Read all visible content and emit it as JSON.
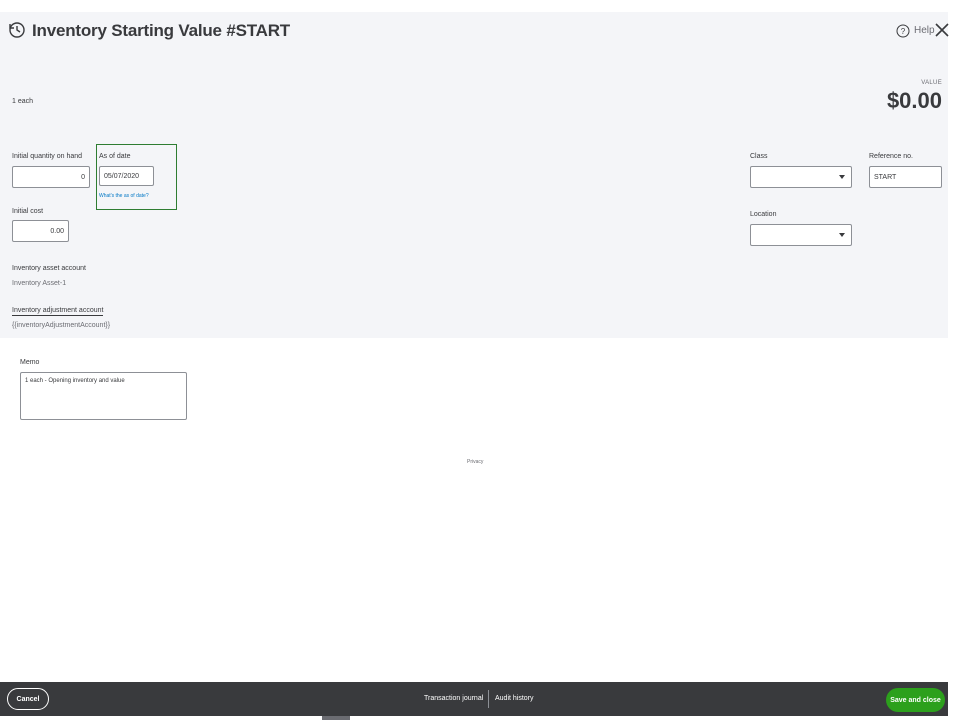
{
  "header": {
    "title": "Inventory Starting Value #START",
    "help_label": "Help"
  },
  "summary": {
    "unit": "1 each",
    "value_label": "VALUE",
    "value_amount": "$0.00"
  },
  "fields": {
    "initial_qty_label": "Initial quantity on hand",
    "initial_qty_value": "0",
    "as_of_label": "As of date",
    "as_of_value": "05/07/2020",
    "as_of_link": "What's the as of date?",
    "initial_cost_label": "Initial cost",
    "initial_cost_value": "0.00",
    "asset_account_label": "Inventory asset account",
    "asset_account_value": "Inventory Asset-1",
    "adjustment_account_label": "Inventory adjustment account",
    "adjustment_account_value": "{{inventoryAdjustmentAccount}}",
    "class_label": "Class",
    "class_value": "",
    "location_label": "Location",
    "location_value": "",
    "reference_label": "Reference no.",
    "reference_value": "START"
  },
  "memo": {
    "label": "Memo",
    "value": "1 each - Opening inventory and value"
  },
  "privacy_label": "Privacy",
  "footer": {
    "cancel_label": "Cancel",
    "transaction_journal_label": "Transaction journal",
    "audit_history_label": "Audit history",
    "save_close_label": "Save and close"
  },
  "colors": {
    "panel_bg": "#f4f5f8",
    "footer_bg": "#393a3d",
    "save_button": "#2ca01c",
    "highlight_border": "#2e7d32",
    "link": "#0077c5"
  },
  "icons": {
    "history": "history-icon",
    "help": "help-icon",
    "close": "close-icon",
    "dropdown": "chevron-down-icon"
  }
}
